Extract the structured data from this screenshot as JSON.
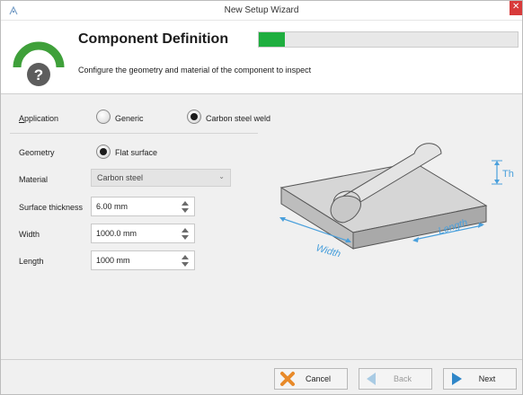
{
  "window": {
    "title": "New Setup Wizard"
  },
  "header": {
    "title": "Component Definition",
    "subtitle": "Configure the geometry and material of the component to inspect",
    "progress_fraction": 0.1
  },
  "form": {
    "application": {
      "label": "Application",
      "options": [
        {
          "label": "Generic",
          "selected": false
        },
        {
          "label": "Carbon steel weld",
          "selected": true
        }
      ]
    },
    "geometry": {
      "label": "Geometry",
      "option": {
        "label": "Flat surface",
        "selected": true
      }
    },
    "material": {
      "label": "Material",
      "value": "Carbon steel"
    },
    "surface_thickness": {
      "label": "Surface thickness",
      "value": "6.00 mm"
    },
    "width": {
      "label": "Width",
      "value": "1000.0 mm"
    },
    "length": {
      "label": "Length",
      "value": "1000 mm"
    }
  },
  "illustration": {
    "labels": {
      "thickness": "Th",
      "width": "Width",
      "length": "Length"
    },
    "colors": {
      "dimension": "#4aa0dc",
      "plate_top": "#d4d4d4",
      "plate_front": "#bdbdbd",
      "plate_side": "#a9a9a9"
    }
  },
  "footer": {
    "cancel_label": "Cancel",
    "back_label": "Back",
    "next_label": "Next"
  },
  "colors": {
    "accent_green": "#1fae3f",
    "logo_green": "#3fa03a",
    "logo_gray": "#5d5d5d",
    "icon_blue": "#2f86c8",
    "icon_orange": "#e88a2a"
  }
}
